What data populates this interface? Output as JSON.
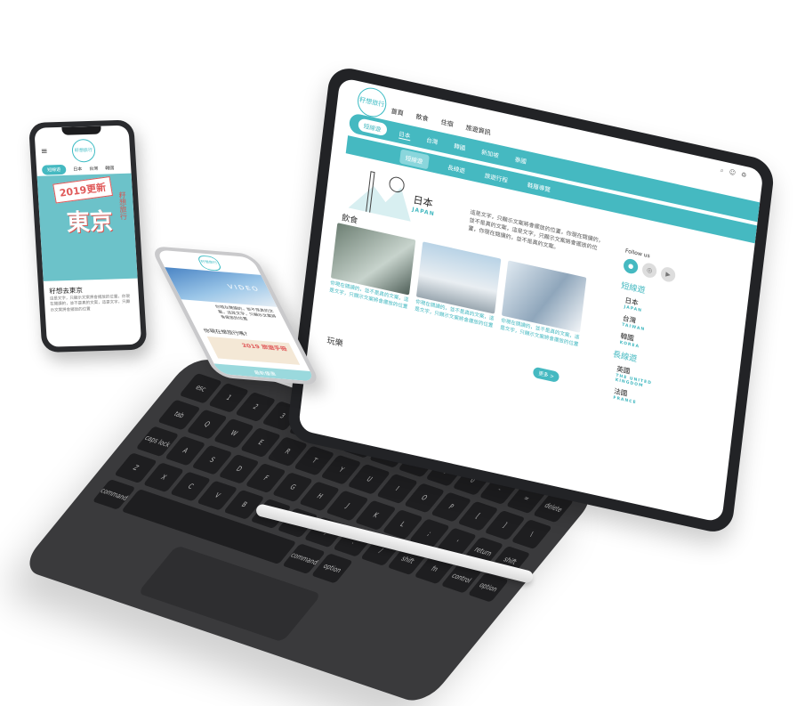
{
  "tablet": {
    "logo": "籽想旅行",
    "nav": [
      "首頁",
      "飲食",
      "住宿",
      "旅遊資訊"
    ],
    "search_pill": "短線遊",
    "tabs": [
      "日本",
      "台灣",
      "韓國",
      "新加坡",
      "泰國"
    ],
    "sub_nav": [
      "短線遊",
      "長線遊",
      "旅遊行程",
      "鞋履導覽"
    ],
    "region_title": "日本",
    "region_en": "JAPAN",
    "intro": "這是文字，只顯示文案將會擺放的位置，你現在閱讀的，並不是真的文案，這是文字，只顯示文案將會擺放的位置，你現在閱讀的，並不是真的文案。",
    "section_food": "飲食",
    "section_fun": "玩樂",
    "cards": [
      {
        "caption": "你現在閱讀的，並不是真的文案，這是文字，只顯示文案將會擺放的位置"
      },
      {
        "caption": "你現在閱讀的，並不是真的文案，這是文字，只顯示文案將會擺放的位置"
      },
      {
        "caption": "你現在閱讀的，並不是真的文案，這是文字，只顯示文案將會擺放的位置"
      }
    ],
    "more": "更多 >",
    "follow": "Follow us",
    "short_header": "短線遊",
    "short_items": [
      {
        "name": "日本",
        "en": "JAPAN"
      },
      {
        "name": "台灣",
        "en": "TAIWAN"
      },
      {
        "name": "韓國",
        "en": "KOREA"
      }
    ],
    "long_header": "長線遊",
    "long_items": [
      {
        "name": "英國",
        "en": "THE UNITED KINGDOM"
      },
      {
        "name": "法國",
        "en": "FRANCE"
      }
    ]
  },
  "phone_left": {
    "logo": "籽想旅行",
    "pill": "短線遊",
    "tabs": [
      "日本",
      "台灣",
      "韓國"
    ],
    "badge": "2019更新",
    "hero_word": "東京",
    "side_tag": "籽想旅行",
    "title": "籽想去東京",
    "body": "這是文字，只顯示文案將會擺放的位置，你現在閱讀的，並不是真的文案，這是文字，只顯示文案將會擺放的位置"
  },
  "phone_mid": {
    "logo": "籽想旅行",
    "video": "VIDEO",
    "text": "你現在閱讀的，並不是真的文案，這是文字，只顯示文案將會擺放的位置",
    "question": "你現在想旅行嗎?",
    "poster": "2019 旅遊手冊",
    "bar": "最新優惠"
  },
  "keyboard": {
    "keys": [
      "esc",
      "1",
      "2",
      "3",
      "4",
      "5",
      "6",
      "7",
      "8",
      "9",
      "0",
      "-",
      "=",
      "delete",
      "tab",
      "Q",
      "W",
      "E",
      "R",
      "T",
      "Y",
      "U",
      "I",
      "O",
      "P",
      "[",
      "]",
      "\\",
      "caps lock",
      "A",
      "S",
      "D",
      "F",
      "G",
      "H",
      "J",
      "K",
      "L",
      ";",
      "'",
      "return",
      "shift",
      "Z",
      "X",
      "C",
      "V",
      "B",
      "N",
      "M",
      ",",
      ".",
      "/",
      "shift",
      "fn",
      "control",
      "option",
      "command",
      "",
      "command",
      "option"
    ]
  },
  "colors": {
    "accent": "#45b9c1",
    "red": "#e05a5a",
    "device": "#222326"
  }
}
